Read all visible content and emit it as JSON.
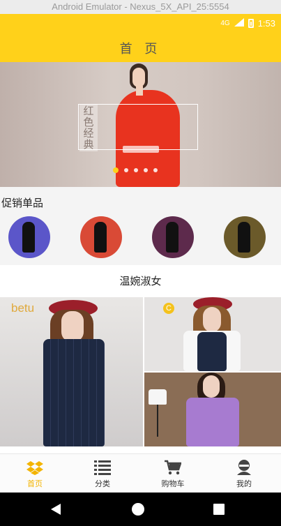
{
  "window": {
    "title": "Android Emulator - Nexus_5X_API_25:5554"
  },
  "status_bar": {
    "network": "4G",
    "time": "1:53"
  },
  "header": {
    "title": "首 页",
    "accent_color": "#ffd11a"
  },
  "banner": {
    "vertical_text": "红色经典",
    "indicator_count": 5,
    "active_index": 0
  },
  "promo": {
    "title": "促销单品",
    "items": [
      "promo-1",
      "promo-2",
      "promo-3",
      "promo-4"
    ]
  },
  "section": {
    "title": "温婉淑女",
    "brand_logo": "betu",
    "badge": "C"
  },
  "bottom_nav": {
    "items": [
      {
        "label": "首页",
        "icon": "home-box-icon",
        "active": true
      },
      {
        "label": "分类",
        "icon": "category-list-icon",
        "active": false
      },
      {
        "label": "购物车",
        "icon": "cart-icon",
        "active": false
      },
      {
        "label": "我的",
        "icon": "user-icon",
        "active": false
      }
    ],
    "active_color": "#f3b400"
  }
}
